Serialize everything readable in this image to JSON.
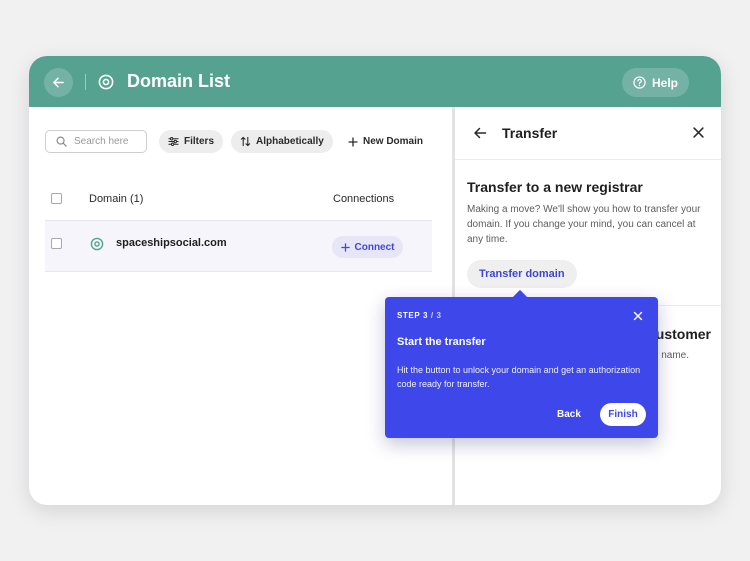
{
  "header": {
    "title": "Domain List",
    "help_label": "Help",
    "color": "#55a290"
  },
  "toolbar": {
    "search_placeholder": "Search here",
    "filters_label": "Filters",
    "sort_label": "Alphabetically",
    "new_domain_label": "New Domain"
  },
  "table": {
    "columns": [
      "Domain (1)",
      "Connections"
    ],
    "rows": [
      {
        "domain": "spaceshipsocial.com",
        "connect_label": "Connect"
      }
    ]
  },
  "panel": {
    "title": "Transfer",
    "section": {
      "title": "Transfer to a new registrar",
      "description": "Making a move? We'll show you how to transfer your domain. If you change your mind, you can cancel at any time.",
      "button_label": "Transfer domain"
    },
    "section2": {
      "title_visible": "ustomer",
      "desc_visible": "n name."
    }
  },
  "tooltip": {
    "step_label": "STEP 3",
    "step_total": " / 3",
    "title": "Start the transfer",
    "body": "Hit the button to unlock your domain and get an authorization code ready for transfer.",
    "back_label": "Back",
    "finish_label": "Finish",
    "color": "#3d47ea"
  },
  "icons": [
    "arrow-left-icon",
    "domain-logo-icon",
    "help-circle-icon",
    "search-icon",
    "filter-icon",
    "sort-icon",
    "plus-icon",
    "close-icon"
  ]
}
